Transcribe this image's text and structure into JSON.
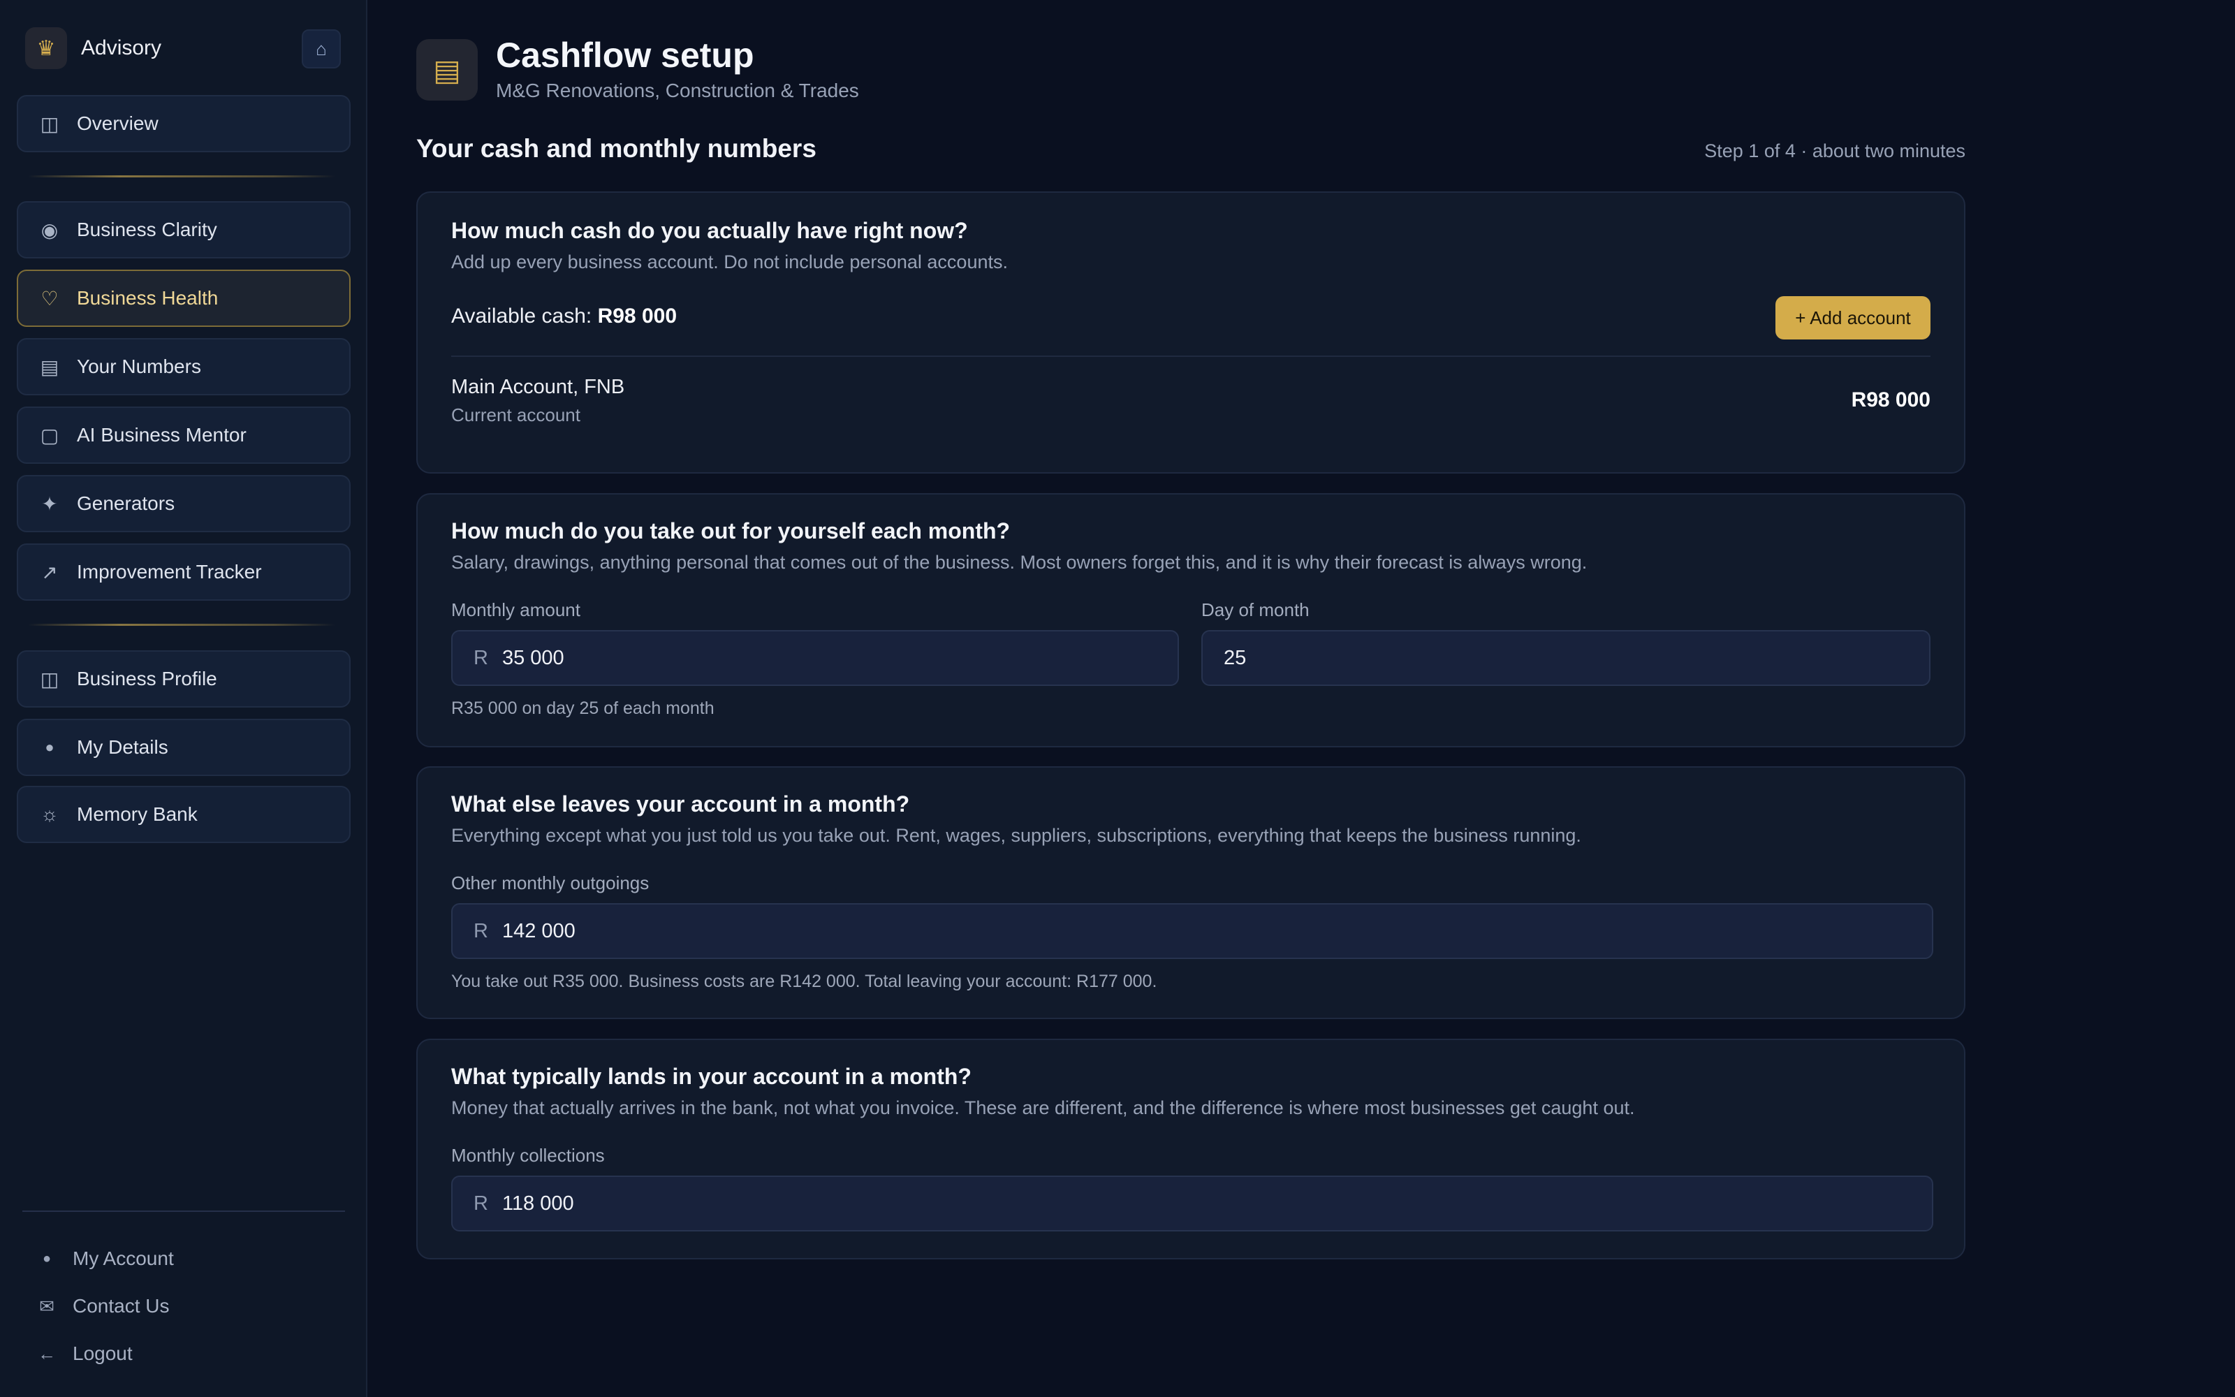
{
  "sidebar": {
    "brand": {
      "icon": "crown-icon",
      "glyph": "♛",
      "name": "Advisory"
    },
    "home_glyph": "⌂",
    "items": [
      {
        "label": "Overview",
        "glyph": "◫",
        "icon": "overview-icon"
      },
      {
        "label": "Business Clarity",
        "glyph": "◉",
        "icon": "target-icon"
      },
      {
        "label": "Business Health",
        "glyph": "♡",
        "icon": "heart-icon",
        "active": true
      },
      {
        "label": "Your Numbers",
        "glyph": "▤",
        "icon": "numbers-icon"
      },
      {
        "label": "AI Business Mentor",
        "glyph": "▢",
        "icon": "chat-icon"
      },
      {
        "label": "Generators",
        "glyph": "✦",
        "icon": "sparkle-icon"
      },
      {
        "label": "Improvement Tracker",
        "glyph": "↗",
        "icon": "trend-up-icon"
      },
      {
        "label": "Business Profile",
        "glyph": "◫",
        "icon": "profile-icon"
      },
      {
        "label": "My Details",
        "glyph": "●",
        "icon": "user-icon"
      },
      {
        "label": "Memory Bank",
        "glyph": "☼",
        "icon": "memory-icon"
      }
    ],
    "bottom": [
      {
        "label": "My Account",
        "glyph": "●",
        "icon": "account-icon"
      },
      {
        "label": "Contact Us",
        "glyph": "✉",
        "icon": "mail-icon"
      },
      {
        "label": "Logout",
        "glyph": "←",
        "icon": "logout-icon"
      }
    ]
  },
  "header": {
    "glyph": "▤",
    "title": "Cashflow setup",
    "subtitle": "M&G Renovations, Construction & Trades"
  },
  "section": {
    "title": "Your cash and monthly numbers",
    "step": "Step 1 of 4 · about two minutes"
  },
  "cash_card": {
    "question": "How much cash do you actually have right now?",
    "help": "Add up every business account. Do not include personal accounts.",
    "available_label": "Available cash: ",
    "available_value": "R98 000",
    "add_button": "+ Add account",
    "account": {
      "name": "Main Account, FNB",
      "type": "Current account",
      "amount": "R98 000"
    }
  },
  "draw_card": {
    "question": "How much do you take out for yourself each month?",
    "help": "Salary, drawings, anything personal that comes out of the business. Most owners forget this, and it is why their forecast is always wrong.",
    "amount_label": "Monthly amount",
    "currency": "R",
    "amount_value": "35 000",
    "day_label": "Day of month",
    "day_value": "25",
    "hint": "R35 000 on day 25 of each month"
  },
  "outgoings_card": {
    "question": "What else leaves your account in a month?",
    "help": "Everything except what you just told us you take out. Rent, wages, suppliers, subscriptions, everything that keeps the business running.",
    "label": "Other monthly outgoings",
    "currency": "R",
    "value": "142 000",
    "hint": "You take out R35 000. Business costs are R142 000. Total leaving your account: R177 000."
  },
  "collections_card": {
    "question": "What typically lands in your account in a month?",
    "help": "Money that actually arrives in the bank, not what you invoice. These are different, and the difference is where most businesses get caught out.",
    "label": "Monthly collections",
    "currency": "R",
    "value": "118 000"
  }
}
